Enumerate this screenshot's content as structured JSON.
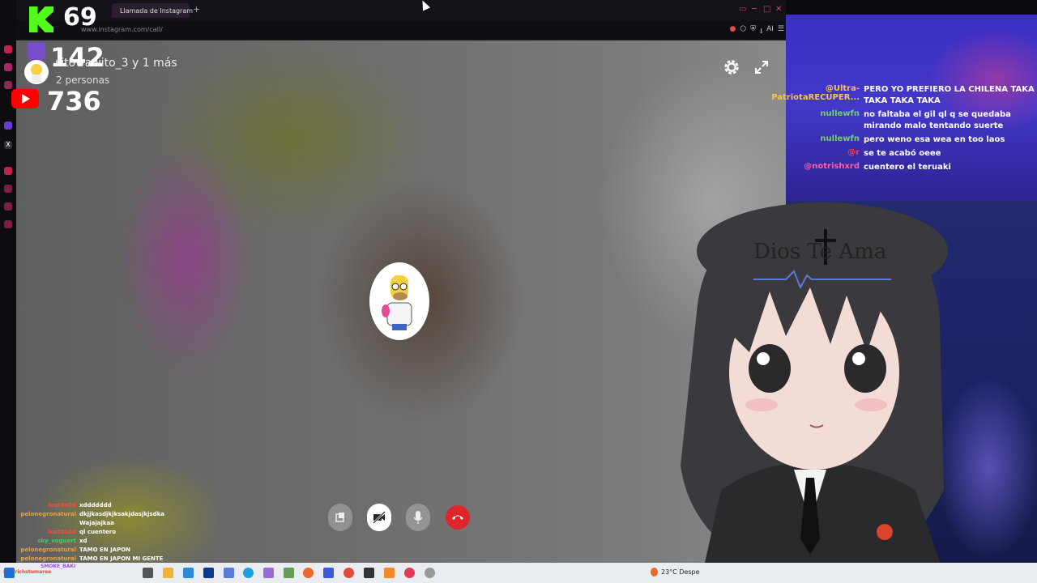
{
  "browser": {
    "active_tab": "Llamada de Instagram",
    "inactive_tab": "",
    "new_tab_symbol": "+",
    "url": "www.instagram.com/call/",
    "ai_label": "AI"
  },
  "overlay": {
    "kick_count": "69",
    "twitch_count": "142",
    "youtube_count": "736"
  },
  "call": {
    "title": "sitowawito_3 y 1 más",
    "participants": "2 personas"
  },
  "top_chat": [
    {
      "name": "@Ultra-PatriotaRECUPER...",
      "color": "#f5c451",
      "msg": "PERO YO PREFIERO LA CHILENA TAKA TAKA TAKA TAKA"
    },
    {
      "name": "nullewfn",
      "color": "#6fd36b",
      "msg": "no faltaba el gil ql q se quedaba mirando malo tentando suerte"
    },
    {
      "name": "nullewfn",
      "color": "#6fd36b",
      "msg": "pero weno esa wea en too laos"
    },
    {
      "name": "@r",
      "color": "#ff3b3b",
      "msg": "se te acabó oeee"
    },
    {
      "name": "@notrishxrd",
      "color": "#ff5ea8",
      "msg": "cuentero el teruaki"
    }
  ],
  "avatar": {
    "shirt_text": "Dios Te Ama"
  },
  "bottom_chat": [
    {
      "name": "lost0n0d",
      "color": "#ff4a4a",
      "msg": "xddddddd"
    },
    {
      "name": "pelonegronatural",
      "color": "#e0a24a",
      "msg": "dkjjkasdjkjksakjdasjkjsdka"
    },
    {
      "name": "",
      "color": "#3fa9f5",
      "msg": "Wajajajkaa"
    },
    {
      "name": "lost0n0d",
      "color": "#ff4a4a",
      "msg": "ql cuentero"
    },
    {
      "name": "sky_voguert",
      "color": "#3fd35e",
      "msg": "xd"
    },
    {
      "name": "pelonegronatural",
      "color": "#e0a24a",
      "msg": "TAMO EN JAPON"
    },
    {
      "name": "pelonegronatural",
      "color": "#e0a24a",
      "msg": "TAMO EN JAPON MI GENTE"
    }
  ],
  "bottom_ticker": {
    "line1": "SMOKE_BAKI",
    "line2": "nikorichstumaree"
  },
  "taskbar": {
    "weather": "23°C  Despe"
  },
  "colors": {
    "kick": "#53fc18",
    "twitch": "#7a4bd8",
    "youtube": "#ff0000",
    "end_call": "#e0242b"
  }
}
